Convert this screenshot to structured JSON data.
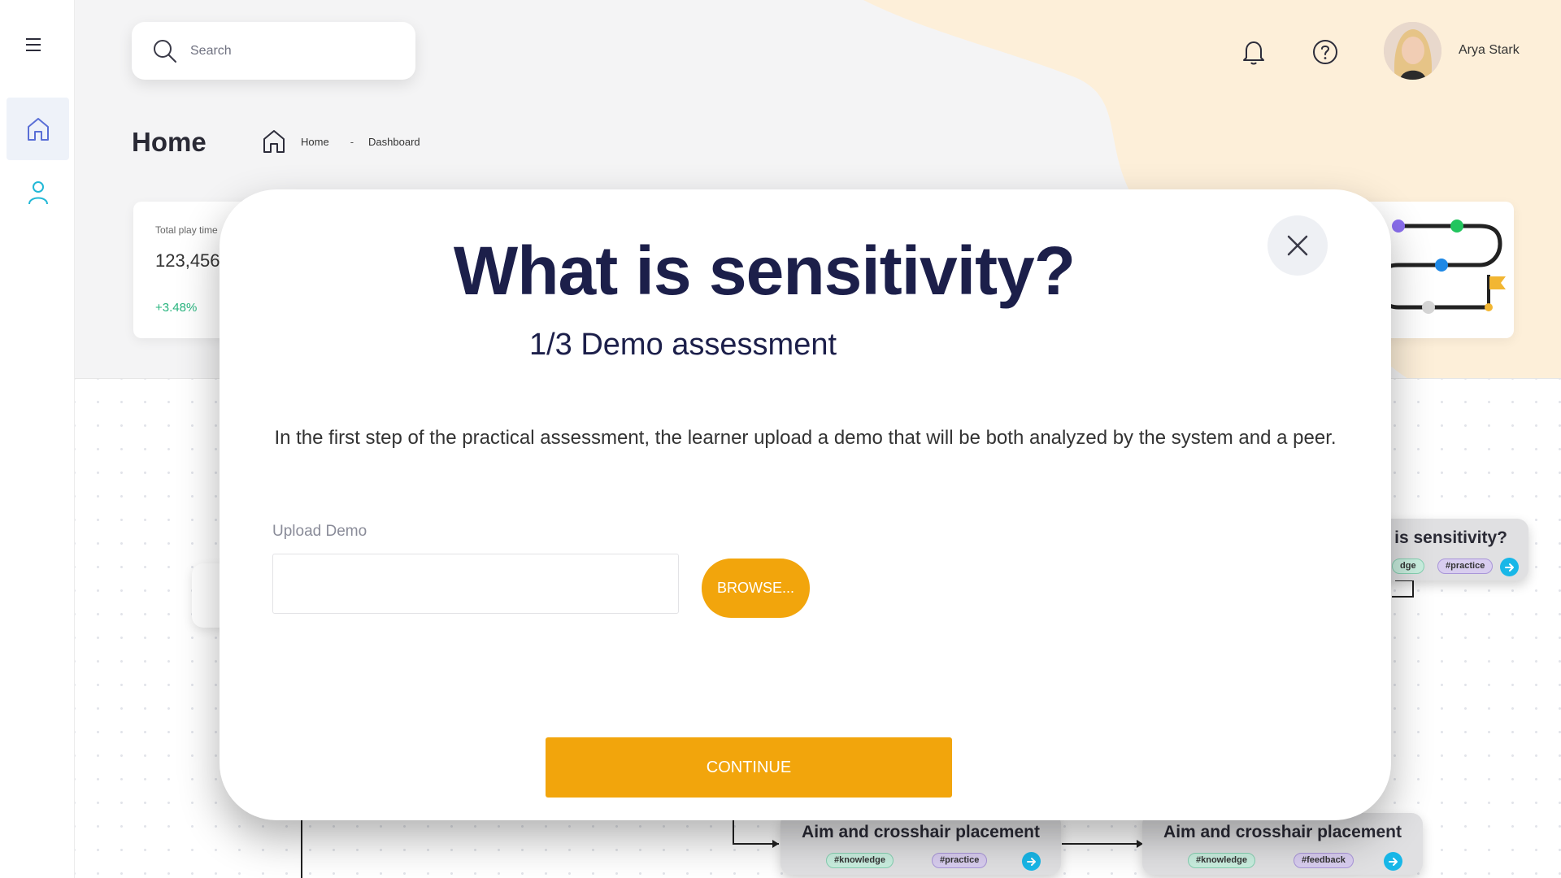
{
  "sidebar": {
    "menu_icon": "hamburger-icon",
    "items": [
      {
        "name": "home",
        "icon": "home-icon",
        "active": true
      },
      {
        "name": "user",
        "icon": "user-icon",
        "active": false
      }
    ]
  },
  "header": {
    "search_placeholder": "Search",
    "notification_icon": "bell-icon",
    "help_icon": "help-circle-icon",
    "user_name": "Arya Stark"
  },
  "page": {
    "title": "Home",
    "breadcrumb": {
      "home": "Home",
      "separator": "-",
      "current": "Dashboard"
    }
  },
  "stat_card": {
    "label": "Total play time",
    "value": "123,456",
    "change": "+3.48%",
    "change_color": "#27b47e"
  },
  "flow_nodes": [
    {
      "title": "is sensitivity?",
      "tags": [
        "dge",
        "#practice"
      ]
    },
    {
      "title": "Aim and crosshair placement",
      "tags": [
        "#knowledge",
        "#practice"
      ]
    },
    {
      "title": "Aim and crosshair placement",
      "tags": [
        "#knowledge",
        "#feedback"
      ]
    }
  ],
  "modal": {
    "title": "What is sensitivity?",
    "subtitle": "1/3 Demo assessment",
    "description": "In the first step of the practical assessment, the learner upload a demo that will be both analyzed by the system and a peer.",
    "upload_label": "Upload Demo",
    "upload_value": "",
    "browse_label": "BROWSE...",
    "continue_label": "CONTINUE",
    "close_icon": "close-icon"
  },
  "colors": {
    "accent": "#f2a50c",
    "title_navy": "#1c1f4a",
    "go_button": "#18b7e8",
    "tag_knowledge": "#c9eedf",
    "tag_practice": "#d8cdef"
  }
}
